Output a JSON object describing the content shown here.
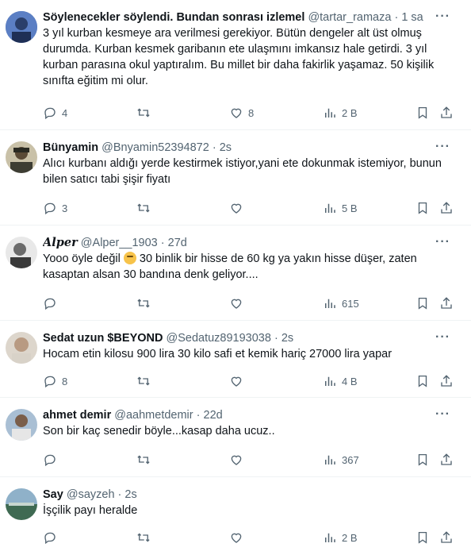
{
  "tweets": [
    {
      "name": "Söylenecekler söylendi. Bundan sonrası izlemel",
      "handle": "@tartar_ramaza",
      "dot": "·",
      "time": "1 sa",
      "text": "3 yıl kurban kesmeye ara verilmesi gerekiyor. Bütün dengeler alt üst olmuş durumda. Kurban kesmek garibanın ete ulaşmını imkansız hale getirdi. 3 yıl kurban parasına okul yaptıralım. Bu millet bir daha fakirlik yaşamaz. 50 kişilik sınıfta eğitim mi olur.",
      "replies": "4",
      "retweets": "",
      "likes": "8",
      "views": "2 B",
      "avatar_color": "#3b5fa8"
    },
    {
      "name": "Bünyamin",
      "handle": "@Bnyamin52394872",
      "dot": "·",
      "time": "2s",
      "text": "Alıcı kurbanı aldığı yerde kestirmek istiyor,yani ete dokunmak istemiyor, bunun bilen satıcı tabi şişir fiyatı",
      "replies": "3",
      "retweets": "",
      "likes": "",
      "views": "5 B",
      "avatar_color": "#4a4a3c"
    },
    {
      "name": "Alper",
      "handle": "@Alper__1903",
      "dot": "·",
      "time": "27d",
      "text_before": "Yooo öyle değil ",
      "text_after": " 30 binlik bir hisse de 60 kg ya yakın hisse düşer, zaten kasaptan alsan 30 bandına denk geliyor....",
      "replies": "",
      "retweets": "",
      "likes": "",
      "views": "615",
      "avatar_color": "#6a6a6a"
    },
    {
      "name": "Sedat uzun $BEYOND",
      "handle": "@Sedatuz89193038",
      "dot": "·",
      "time": "2s",
      "text": "Hocam etin kilosu 900 lira 30 kilo safi et kemik hariç 27000 lira yapar",
      "replies": "8",
      "retweets": "",
      "likes": "",
      "views": "4 B",
      "avatar_color": "#a08878"
    },
    {
      "name": "ahmet demir",
      "handle": "@aahmetdemir",
      "dot": "·",
      "time": "22d",
      "text": "Son bir kaç senedir böyle...kasap daha ucuz..",
      "replies": "",
      "retweets": "",
      "likes": "",
      "views": "367",
      "avatar_color": "#7a8fa8"
    },
    {
      "name": "Say",
      "handle": "@sayzeh",
      "dot": "·",
      "time": "2s",
      "text": "İşçilik payı heralde",
      "replies": "",
      "retweets": "",
      "likes": "",
      "views": "2 B",
      "avatar_color": "#5a7a6a"
    }
  ],
  "icons": {
    "more": "more-icon",
    "reply": "reply-icon",
    "retweet": "retweet-icon",
    "like": "heart-icon",
    "views": "views-icon",
    "bookmark": "bookmark-icon",
    "share": "share-icon"
  },
  "more_label": "···"
}
